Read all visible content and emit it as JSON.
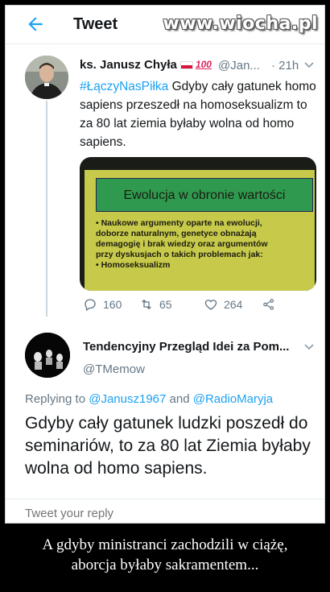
{
  "header": {
    "title": "Tweet",
    "back_icon": "arrow-left-icon",
    "watermark": "www.wiocha.pl"
  },
  "tweet1": {
    "author": "ks. Janusz Chyła",
    "badge_100": "100",
    "handle": "@Jan...",
    "time": "· 21h",
    "hashtag": "#ŁączyNasPiłka",
    "text": " Gdyby cały gatunek homo sapiens przeszedł na homoseksualizm to za 80 lat ziemia byłaby wolna od homo sapiens.",
    "media": {
      "slide_title": "Ewolucja w obronie wartości",
      "lines": [
        "• Naukowe argumenty oparte na ewolucji,",
        "  doborze naturalnym, genetyce obnażają",
        "  demagogię i brak wiedzy oraz argumentów",
        "  przy dyskusjach o takich problemach jak:",
        "• Homoseksualizm"
      ]
    },
    "replies": "160",
    "retweets": "65",
    "likes": "264"
  },
  "tweet2": {
    "author": "Tendencyjny Przegląd Idei za Pom...",
    "handle": "@TMemow",
    "replying_label": "Replying to",
    "mention1": "@Janusz1967",
    "and": "and",
    "mention2": "@RadioMaryja",
    "text": "Gdyby cały gatunek ludzki poszedł do seminariów, to za 80 lat Ziemia byłaby wolna od homo sapiens."
  },
  "reply": {
    "placeholder": "Tweet your reply"
  },
  "caption": {
    "line1": "A gdyby ministranci zachodzili w ciążę,",
    "line2": "aborcja byłaby sakramentem..."
  },
  "colors": {
    "accent": "#1da1f2",
    "secondary_text": "#657786"
  }
}
